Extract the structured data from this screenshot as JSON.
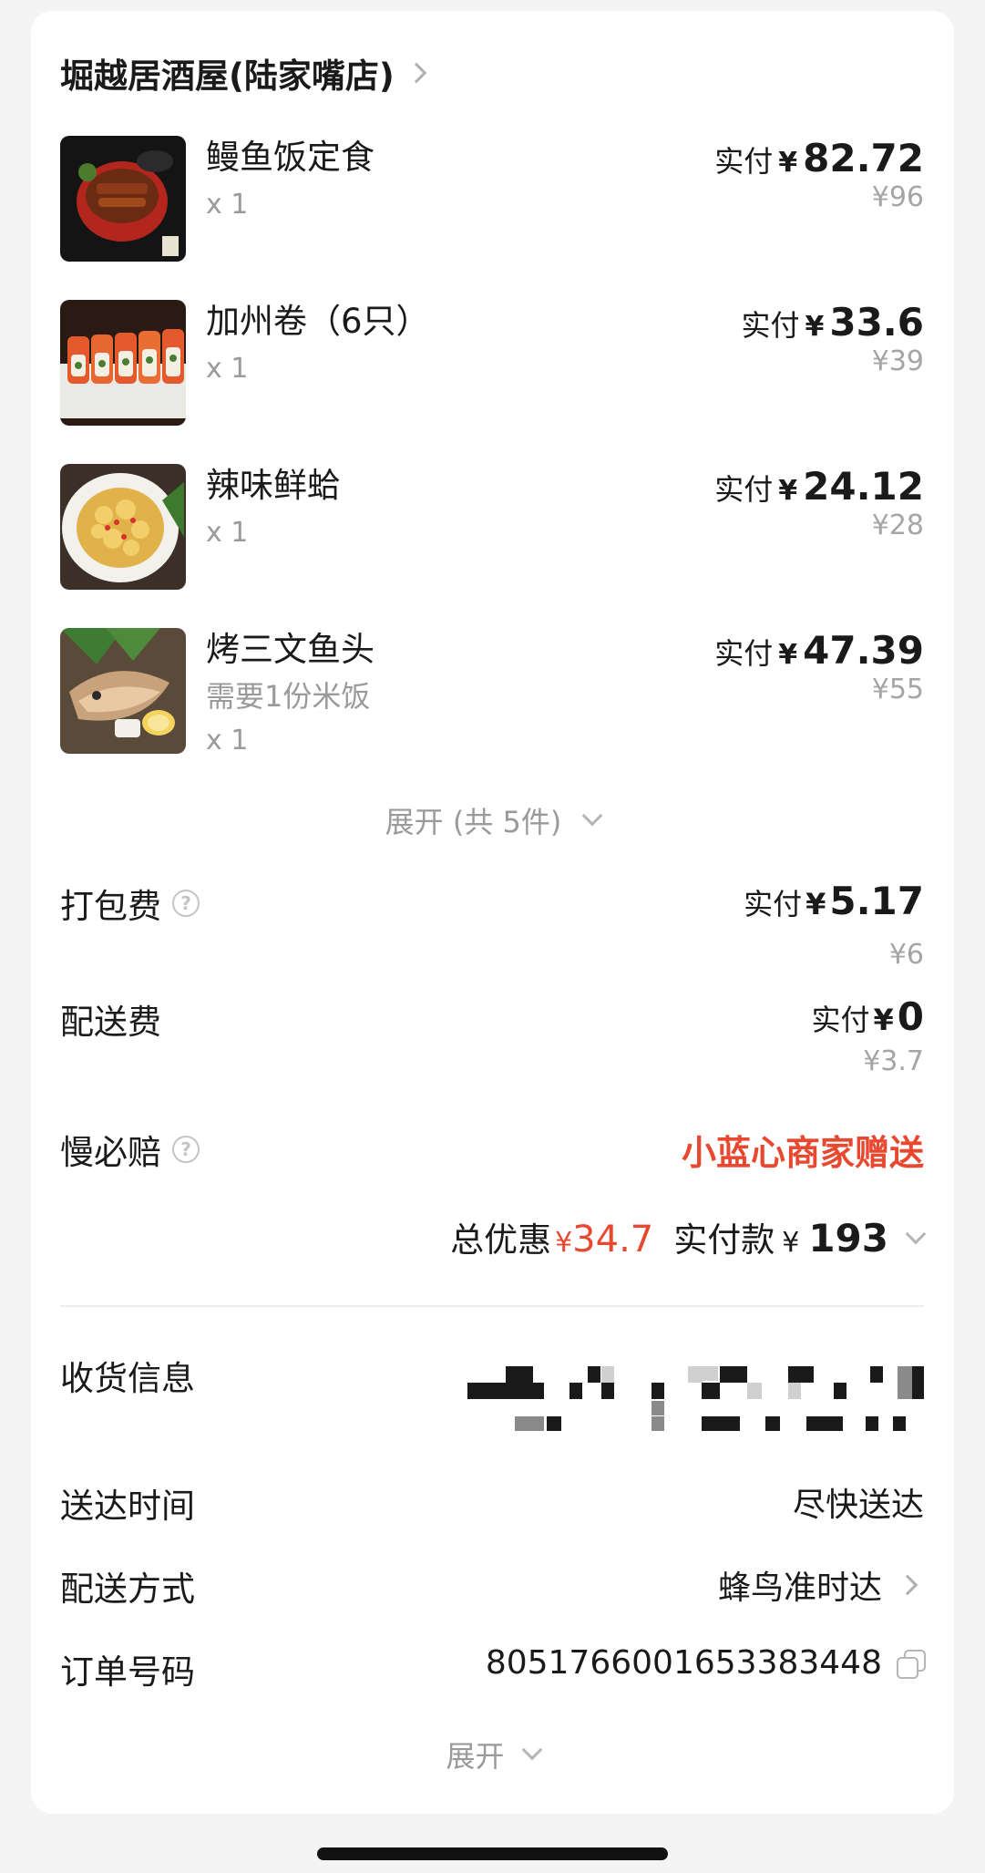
{
  "shop": {
    "name": "堀越居酒屋(陆家嘴店)"
  },
  "items": [
    {
      "name": "鳗鱼饭定食",
      "note": "",
      "qty": "x 1",
      "paid_label": "实付",
      "currency": "¥",
      "paid": "82.72",
      "original": "¥96",
      "icon": "eel-rice-photo"
    },
    {
      "name": "加州卷（6只）",
      "note": "",
      "qty": "x 1",
      "paid_label": "实付",
      "currency": "¥",
      "paid": "33.6",
      "original": "¥39",
      "icon": "california-roll-photo"
    },
    {
      "name": "辣味鲜蛤",
      "note": "",
      "qty": "x 1",
      "paid_label": "实付",
      "currency": "¥",
      "paid": "24.12",
      "original": "¥28",
      "icon": "spicy-clam-photo"
    },
    {
      "name": "烤三文鱼头",
      "note": "需要1份米饭",
      "qty": "x 1",
      "paid_label": "实付",
      "currency": "¥",
      "paid": "47.39",
      "original": "¥55",
      "icon": "grilled-salmon-head-photo"
    }
  ],
  "expand_items": "展开 (共 5件)",
  "fees": {
    "packing": {
      "label": "打包费",
      "paid_label": "实付",
      "currency": "¥",
      "paid": "5.17",
      "original": "¥6"
    },
    "delivery": {
      "label": "配送费",
      "paid_label": "实付",
      "currency": "¥",
      "paid": "0",
      "original": "¥3.7"
    },
    "late_comp": {
      "label": "慢必赔",
      "value": "小蓝心商家赠送"
    }
  },
  "summary": {
    "discount_label": "总优惠",
    "discount_currency": "¥",
    "discount": "34.7",
    "paid_label": "实付款",
    "paid_currency": "¥",
    "paid": "193"
  },
  "info": {
    "address_label": "收货信息",
    "delivery_time_label": "送达时间",
    "delivery_time": "尽快送达",
    "delivery_method_label": "配送方式",
    "delivery_method": "蜂鸟准时达",
    "order_no_label": "订单号码",
    "order_no": "8051766001653383448"
  },
  "expand_more": "展开",
  "colors": {
    "accent_red": "#e8482f",
    "muted": "#9a9a9a",
    "text": "#1a1a1a"
  }
}
